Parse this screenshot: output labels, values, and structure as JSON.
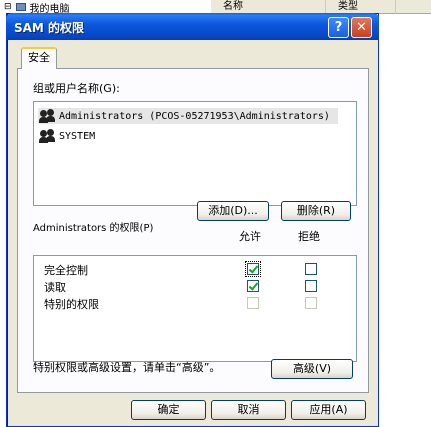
{
  "background": {
    "tree_item": "我的电脑",
    "columns": [
      "名称",
      "类型"
    ]
  },
  "dialog": {
    "title": "SAM 的权限",
    "help_label": "?",
    "close_label": "✕",
    "tab": "安全",
    "group_label": "组或用户名称(G):",
    "users": [
      {
        "name": "Administrators (PCOS-05271953\\Administrators)",
        "selected": true
      },
      {
        "name": "SYSTEM",
        "selected": false
      }
    ],
    "add_button": "添加(D)...",
    "remove_button": "删除(R)",
    "permissions_label": "Administrators 的权限(P)",
    "allow_header": "允许",
    "deny_header": "拒绝",
    "permissions": [
      {
        "name": "完全控制",
        "allow": true,
        "deny": false,
        "enabled": true
      },
      {
        "name": "读取",
        "allow": true,
        "deny": false,
        "enabled": true
      },
      {
        "name": "特别的权限",
        "allow": false,
        "deny": false,
        "enabled": false
      }
    ],
    "advanced_hint": "特别权限或高级设置，请单击“高级”。",
    "advanced_button": "高级(V)",
    "ok_button": "确定",
    "cancel_button": "取消",
    "apply_button": "应用(A)"
  }
}
